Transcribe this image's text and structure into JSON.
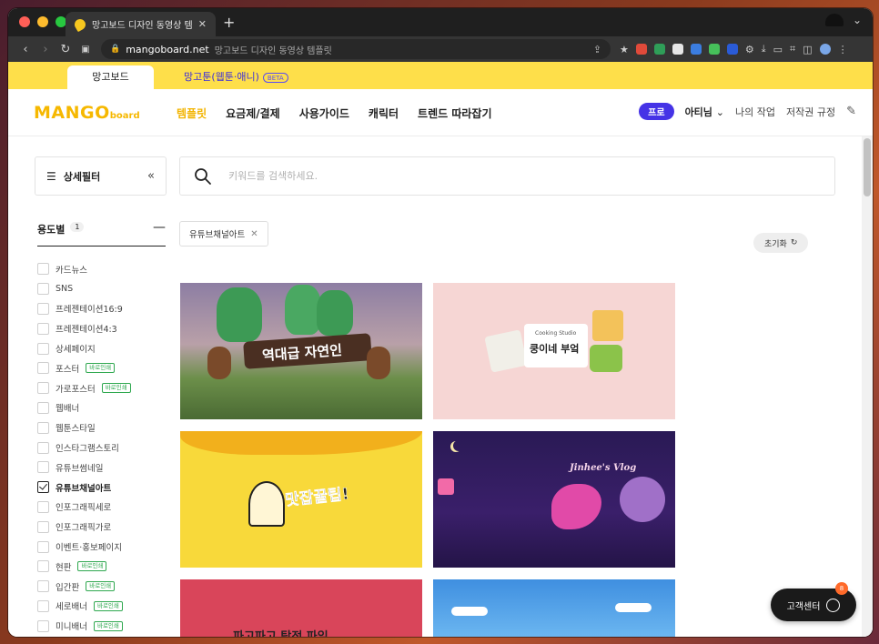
{
  "browser": {
    "tab_title": "망고보드 디자인 동영상 템플릿",
    "url_host": "mangoboard.net",
    "url_rest": "망고보드 디자인 동영상 템플릿"
  },
  "service_tabs": {
    "tab1": "망고보드",
    "tab2": "망고툰(웹툰·애니)",
    "beta": "BETA"
  },
  "header": {
    "logo_main": "MANGO",
    "logo_sub": "board",
    "nav": [
      "템플릿",
      "요금제/결제",
      "사용가이드",
      "캐릭터",
      "트렌드 따라잡기"
    ],
    "pro_badge": "프로",
    "user": "아티님",
    "my_work": "나의 작업",
    "copyright": "저작권 규정"
  },
  "filter": {
    "title": "상세필터",
    "collapse": "«"
  },
  "search": {
    "placeholder": "키워드를 검색하세요."
  },
  "category": {
    "title": "용도별",
    "count": "1",
    "items": [
      {
        "label": "카드뉴스",
        "checked": false,
        "tag": ""
      },
      {
        "label": "SNS",
        "checked": false,
        "tag": ""
      },
      {
        "label": "프레젠테이션16:9",
        "checked": false,
        "tag": ""
      },
      {
        "label": "프레젠테이션4:3",
        "checked": false,
        "tag": ""
      },
      {
        "label": "상세페이지",
        "checked": false,
        "tag": ""
      },
      {
        "label": "포스터",
        "checked": false,
        "tag": "바로인쇄"
      },
      {
        "label": "가로포스터",
        "checked": false,
        "tag": "바로인쇄"
      },
      {
        "label": "웹배너",
        "checked": false,
        "tag": ""
      },
      {
        "label": "웹툰스타일",
        "checked": false,
        "tag": ""
      },
      {
        "label": "인스타그램스토리",
        "checked": false,
        "tag": ""
      },
      {
        "label": "유튜브썸네일",
        "checked": false,
        "tag": ""
      },
      {
        "label": "유튜브채널아트",
        "checked": true,
        "tag": ""
      },
      {
        "label": "인포그래픽세로",
        "checked": false,
        "tag": ""
      },
      {
        "label": "인포그래픽가로",
        "checked": false,
        "tag": ""
      },
      {
        "label": "이벤트·홍보페이지",
        "checked": false,
        "tag": ""
      },
      {
        "label": "현판",
        "checked": false,
        "tag": "바로인쇄"
      },
      {
        "label": "입간판",
        "checked": false,
        "tag": "바로인쇄"
      },
      {
        "label": "세로배너",
        "checked": false,
        "tag": "바로인쇄"
      },
      {
        "label": "미니배너",
        "checked": false,
        "tag": "바로인쇄"
      }
    ]
  },
  "active_filter": {
    "chip": "유튜브채널아트",
    "reset": "초기화"
  },
  "cards": [
    {
      "title": "역대급 자연인",
      "bg": "#7a6a8a"
    },
    {
      "title": "쿵이네 부엌",
      "sub": "Cooking Studio",
      "bg": "#f7d3d3"
    },
    {
      "title": "맛잡꿀팁!",
      "bg": "#f8d93a"
    },
    {
      "title": "Jinhee's Vlog",
      "bg": "#3a1f6a"
    },
    {
      "title": "파고파고 탐정 파일",
      "bg": "#d9455a"
    },
    {
      "title": "",
      "bg": "#4aa0e8"
    }
  ],
  "help": {
    "label": "고객센터",
    "badge": "8"
  },
  "colors": {
    "accent_yellow": "#fedf4a",
    "pro_purple": "#4533e6",
    "logo": "#f6b800",
    "tag_green": "#2fa84f"
  }
}
